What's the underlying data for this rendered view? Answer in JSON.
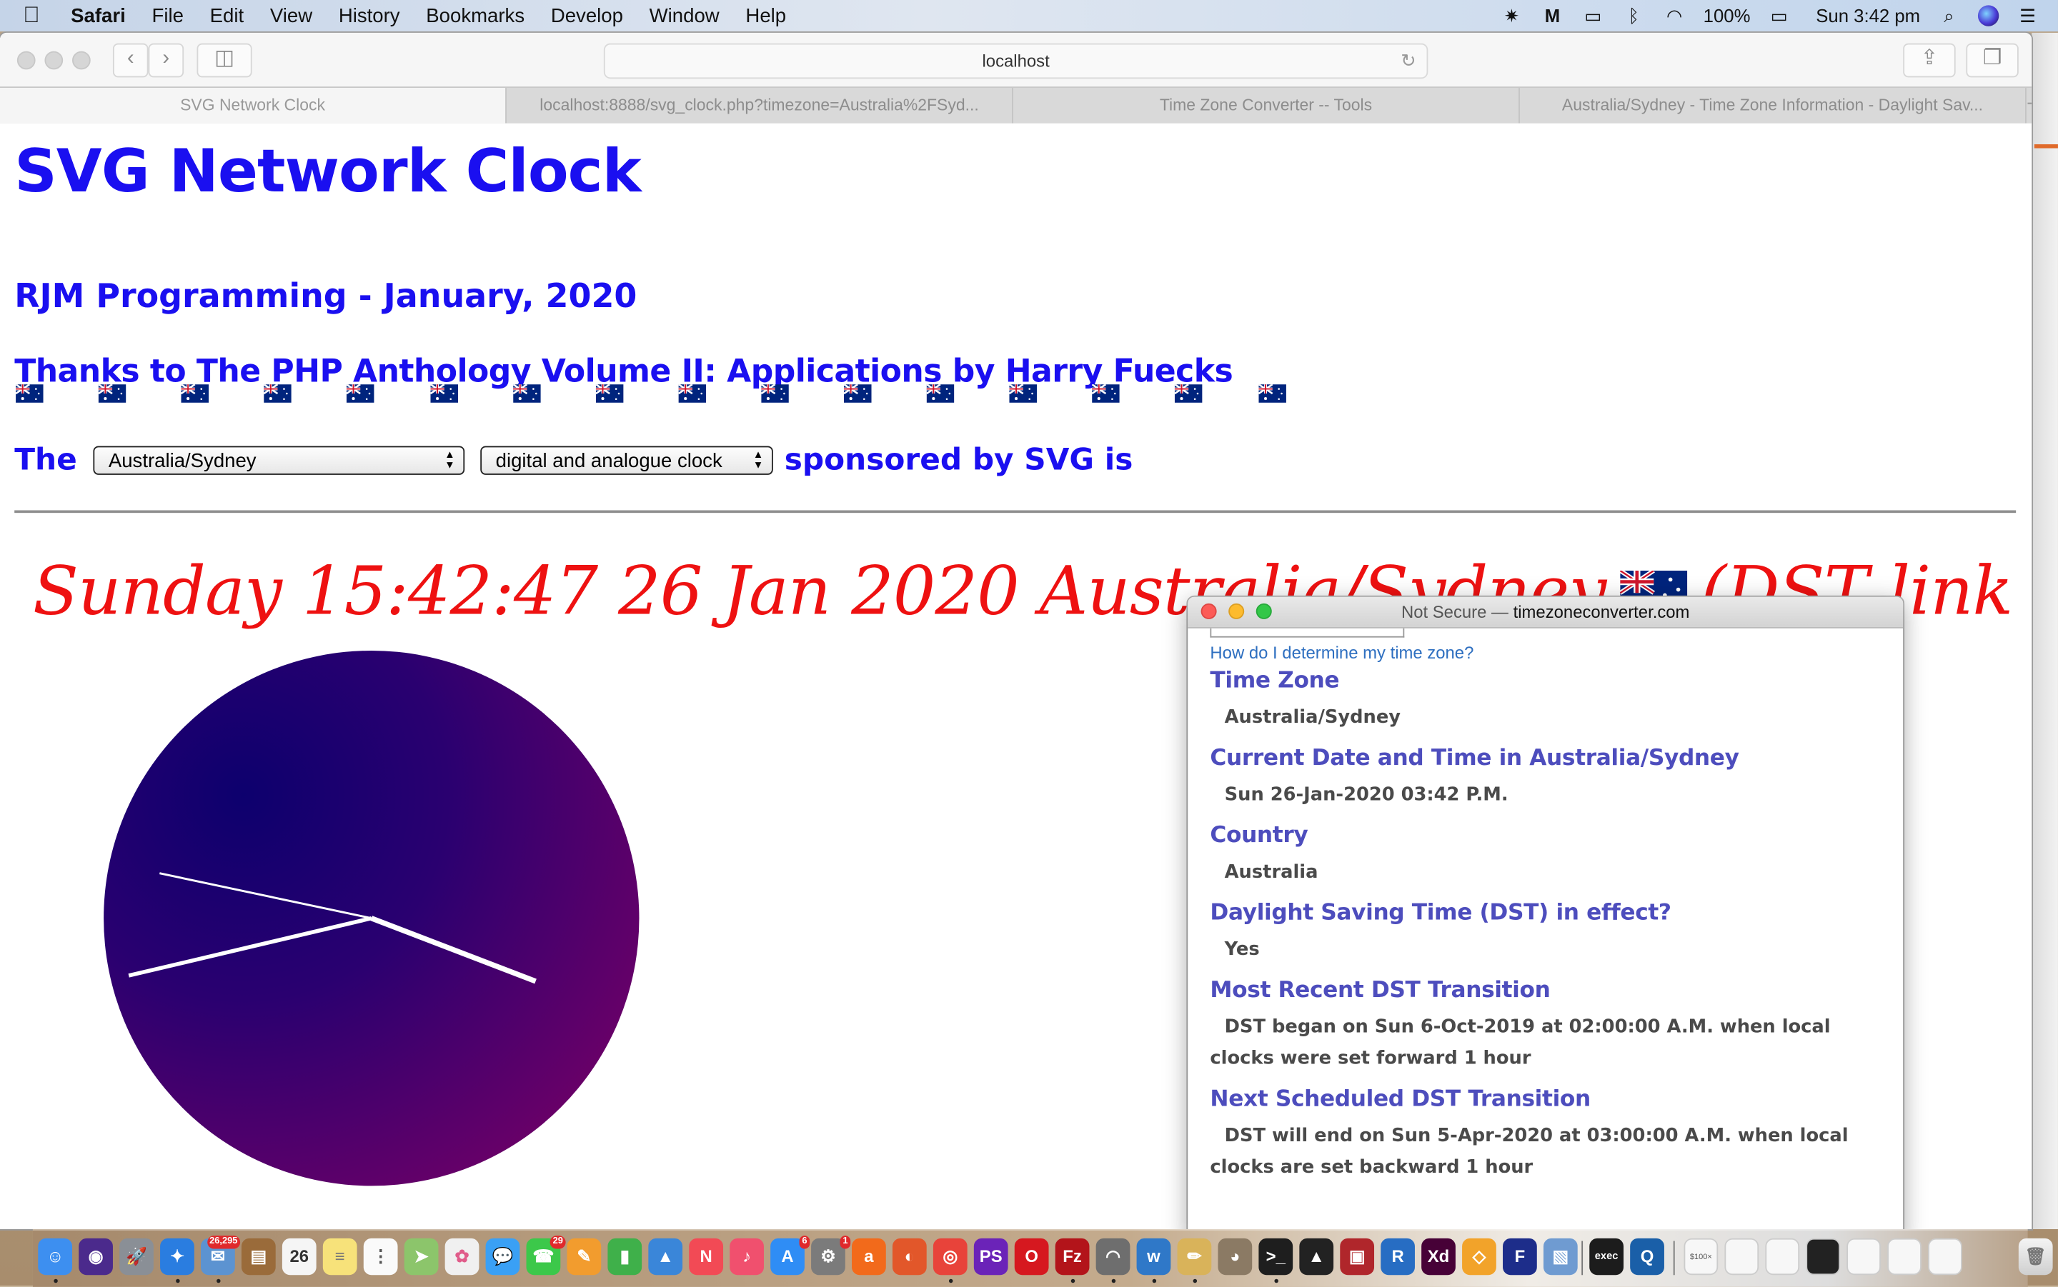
{
  "menubar": {
    "apple_icon": "apple-logo",
    "app_name": "Safari",
    "items": [
      "File",
      "Edit",
      "View",
      "History",
      "Bookmarks",
      "Develop",
      "Window",
      "Help"
    ],
    "status": {
      "battery": "100%",
      "clock": "Sun 3:42 pm",
      "icons": [
        "avast-icon",
        "malwarebytes-icon",
        "airplay-icon",
        "bluetooth-icon",
        "wifi-icon",
        "battery-icon",
        "spotlight-icon",
        "siri-icon",
        "notification-center-icon"
      ]
    }
  },
  "browser": {
    "url": "localhost",
    "tabs": [
      {
        "label": "SVG Network Clock",
        "active": true
      },
      {
        "label": "localhost:8888/svg_clock.php?timezone=Australia%2FSyd...",
        "active": false
      },
      {
        "label": "Time Zone Converter -- Tools",
        "active": false
      },
      {
        "label": "Australia/Sydney - Time Zone Information - Daylight Sav...",
        "active": false
      }
    ],
    "new_tab": "+"
  },
  "page": {
    "title": "SVG Network Clock",
    "subtitle": "RJM Programming - January, 2020",
    "thanks": "Thanks to The PHP Anthology Volume II: Applications by Harry Fuecks",
    "flag_count": 16,
    "prefix": "The",
    "timezone_select": "Australia/Sydney",
    "mode_select": "digital and analogue clock",
    "suffix": "sponsored by SVG is",
    "datetime_text": "Sunday 15:42:47 26 Jan 2020 Australia/Sydney",
    "dst_link": "(DST link -+^)",
    "clock": {
      "hours": 15,
      "minutes": 42,
      "seconds": 47,
      "face_colors": {
        "center": "#0d006e",
        "edge": "#6a0068"
      },
      "hand_color": "#ffffff"
    }
  },
  "popup": {
    "title_prefix": "Not Secure —",
    "title_domain": "timezoneconverter.com",
    "help_link": "How do I determine my time zone?",
    "sections": [
      {
        "heading": "Time Zone",
        "value": "Australia/Sydney"
      },
      {
        "heading": "Current Date and Time in Australia/Sydney",
        "value": "Sun 26-Jan-2020 03:42 P.M."
      },
      {
        "heading": "Country",
        "value": "Australia"
      },
      {
        "heading": "Daylight Saving Time (DST) in effect?",
        "value": "Yes"
      },
      {
        "heading": "Most Recent DST Transition",
        "value": "DST began on Sun 6-Oct-2019 at 02:00:00 A.M. when local clocks were set forward 1 hour"
      },
      {
        "heading": "Next Scheduled DST Transition",
        "value": "DST will end on Sun 5-Apr-2020 at 03:00:00 A.M. when local clocks are set backward 1 hour"
      }
    ]
  },
  "dock": {
    "apps": [
      {
        "name": "finder",
        "glyph": "☺",
        "color": "#3d8ff0",
        "running": true
      },
      {
        "name": "siri",
        "glyph": "◉",
        "color": "#4b2a8c"
      },
      {
        "name": "launchpad",
        "glyph": "🚀",
        "color": "#8a8f96"
      },
      {
        "name": "safari",
        "glyph": "✦",
        "color": "#2a7de0",
        "running": true
      },
      {
        "name": "mail",
        "glyph": "✉",
        "color": "#5c93d1",
        "badge": "26,295",
        "running": true
      },
      {
        "name": "contacts",
        "glyph": "▤",
        "color": "#9a6b3a"
      },
      {
        "name": "calendar",
        "glyph": "26",
        "color": "#f5f5f5",
        "text_color": "#333"
      },
      {
        "name": "notes",
        "glyph": "≡",
        "color": "#f7e27a",
        "text_color": "#777"
      },
      {
        "name": "reminders",
        "glyph": "⋮",
        "color": "#fafafa",
        "text_color": "#555"
      },
      {
        "name": "maps",
        "glyph": "➤",
        "color": "#8cc56b"
      },
      {
        "name": "photos",
        "glyph": "✿",
        "color": "#f0f0f0",
        "text_color": "#e05c8a"
      },
      {
        "name": "messages",
        "glyph": "💬",
        "color": "#3aa0f5"
      },
      {
        "name": "facetime",
        "glyph": "☎",
        "color": "#3cc84a",
        "badge": "29"
      },
      {
        "name": "pages",
        "glyph": "✎",
        "color": "#f29c2e"
      },
      {
        "name": "numbers",
        "glyph": "▮",
        "color": "#3fb04a"
      },
      {
        "name": "keynote",
        "glyph": "▲",
        "color": "#3a86d9"
      },
      {
        "name": "news",
        "glyph": "N",
        "color": "#f24a55"
      },
      {
        "name": "music",
        "glyph": "♪",
        "color": "#f0506e"
      },
      {
        "name": "app-store",
        "glyph": "A",
        "color": "#2f8df5",
        "badge": "6"
      },
      {
        "name": "system-preferences",
        "glyph": "⚙",
        "color": "#7b7b7b",
        "badge": "1"
      },
      {
        "name": "avast",
        "glyph": "a",
        "color": "#f26a1b"
      },
      {
        "name": "firefox",
        "glyph": "◐",
        "color": "#e2572a"
      },
      {
        "name": "chrome",
        "glyph": "◎",
        "color": "#e8433a",
        "running": true
      },
      {
        "name": "phpstorm",
        "glyph": "PS",
        "color": "#6b23b8"
      },
      {
        "name": "opera",
        "glyph": "O",
        "color": "#d6181f"
      },
      {
        "name": "filezilla",
        "glyph": "Fz",
        "color": "#b3141a",
        "running": true
      },
      {
        "name": "sequel-pro",
        "glyph": "◠",
        "color": "#6e6e6e",
        "running": true
      },
      {
        "name": "bbedit",
        "glyph": "w",
        "color": "#2f78c8",
        "running": true
      },
      {
        "name": "textwrangler",
        "glyph": "✏",
        "color": "#d9b35a",
        "running": true
      },
      {
        "name": "gimp",
        "glyph": "◕",
        "color": "#8b7a64"
      },
      {
        "name": "terminal",
        "glyph": ">_",
        "color": "#1e1e1e",
        "running": true
      },
      {
        "name": "inkscape",
        "glyph": "▲",
        "color": "#222"
      },
      {
        "name": "photo-booth",
        "glyph": "▣",
        "color": "#b0262b"
      },
      {
        "name": "r",
        "glyph": "R",
        "color": "#276dc3"
      },
      {
        "name": "adobe-xd",
        "glyph": "Xd",
        "color": "#470137"
      },
      {
        "name": "sketch",
        "glyph": "◇",
        "color": "#f2a32a"
      },
      {
        "name": "fontforge",
        "glyph": "F",
        "color": "#1d2d8a"
      },
      {
        "name": "preview",
        "glyph": "▧",
        "color": "#6f9bd1"
      },
      {
        "name": "exec",
        "glyph": "exec",
        "color": "#1c1c1c"
      },
      {
        "name": "quicktime",
        "glyph": "Q",
        "color": "#1a5fa8"
      }
    ],
    "docs": [
      "$100× A/B",
      "doc-1",
      "doc-2",
      "terminal-window",
      "doc-3",
      "doc-4",
      "doc-5"
    ],
    "trash": "trash-icon"
  }
}
